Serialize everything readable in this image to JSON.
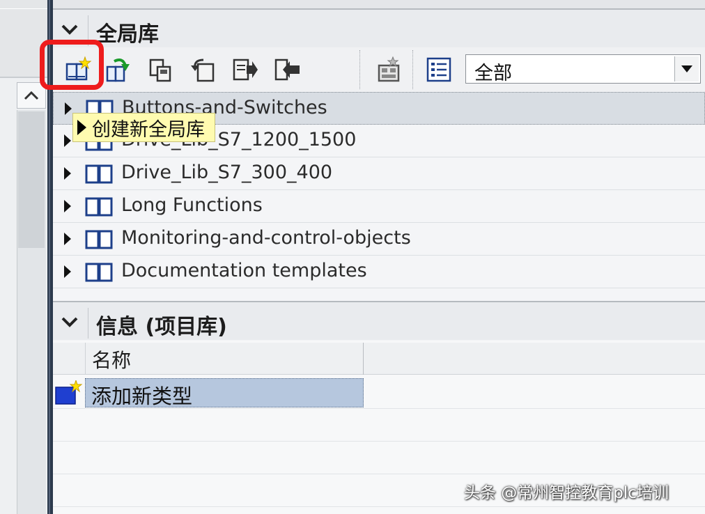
{
  "global_library": {
    "title": "全局库",
    "toolbar": {
      "create_new_library_icon": "book-new-icon",
      "open_library_icon": "book-open-icon",
      "save_library_icon": "save-library-icon",
      "close_library_icon": "close-library-icon",
      "export_icon": "export-icon",
      "import_icon": "import-icon",
      "update_icon": "update-library-icon",
      "view_icon": "list-view-icon",
      "filter_value": "全部"
    },
    "tooltip": "创建新全局库",
    "libraries": [
      {
        "label": "Buttons-and-Switches",
        "selected": true
      },
      {
        "label": "Drive_Lib_S7_1200_1500",
        "selected": false
      },
      {
        "label": "Drive_Lib_S7_300_400",
        "selected": false
      },
      {
        "label": "Long Functions",
        "selected": false
      },
      {
        "label": "Monitoring-and-control-objects",
        "selected": false
      },
      {
        "label": "Documentation templates",
        "selected": false
      }
    ]
  },
  "info": {
    "title": "信息 (项目库)",
    "column_name": "名称",
    "rows": [
      {
        "label": "添加新类型",
        "icon": "add-new-type-icon"
      }
    ]
  },
  "watermark": "头条 @常州智控教育plc培训",
  "colors": {
    "highlight_box": "#ee1c1c",
    "tooltip_bg": "#fffbb0",
    "selection_bg": "#b6c7de",
    "divider": "#2c3a4d"
  }
}
